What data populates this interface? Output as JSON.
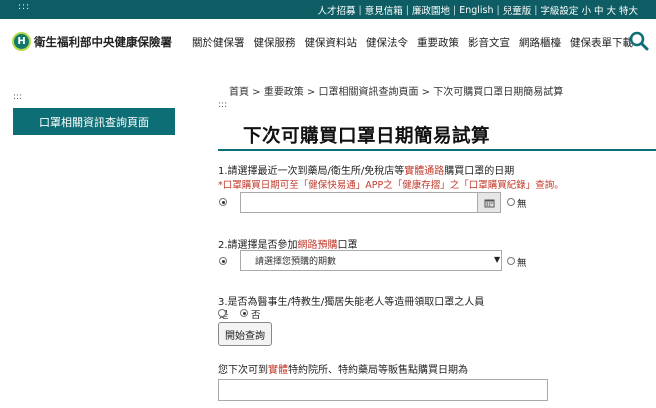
{
  "topbar": {
    "accesskey": ":::",
    "links": [
      "人才招募",
      "意見信箱",
      "廉政園地",
      "English",
      "兒童版",
      "字級設定"
    ],
    "font_sizes": [
      "小",
      "中",
      "大",
      "特大"
    ],
    "separator": "|"
  },
  "header": {
    "logo_letter": "H",
    "site_title": "衛生福利部中央健康保險署",
    "nav": [
      "關於健保署",
      "健保服務",
      "健保資料站",
      "健保法令",
      "重要政策",
      "影音文宣",
      "網路櫃檯",
      "健保表單下載"
    ]
  },
  "sidebar": {
    "accesskey": ":::",
    "button_label": "口罩相關資訊查詢頁面"
  },
  "main": {
    "breadcrumb": "首頁 > 重要政策 > 口罩相關資訊查詢頁面 > 下次可購買口罩日期簡易試算",
    "accesskey": ":::",
    "title": "下次可購買口罩日期簡易試算",
    "q1": {
      "pre": "1.請選擇最近一次到藥局/衛生所/免稅店等",
      "highlight": "實體通路",
      "post": "購買口罩的日期",
      "note": "*口罩購買日期可至「健保快易通」APP之「健康存摺」之「口罩購買紀錄」查詢。",
      "date_value": "",
      "none_label": "無"
    },
    "q2": {
      "pre": "2.請選擇是否參加",
      "highlight": "網路預購",
      "post": "口罩",
      "select_value": "請選擇您預購的期數",
      "none_label": "無"
    },
    "q3": {
      "label": "3.是否為醫事生/特教生/獨居失能老人等造冊領取口罩之人員",
      "yes_label": "是",
      "no_label": "否",
      "selected": "否"
    },
    "query_button": "開始查詢",
    "result": {
      "pre": "您下次可到",
      "highlight": "實體",
      "post": "特約院所、特約藥局等販售點購買日期為",
      "value": ""
    }
  },
  "colors": {
    "topbar": "#0e5d64",
    "accent": "#0e6e76",
    "highlight_red": "#c0392b"
  },
  "icons": {
    "search": "magnifier-icon",
    "calendar": "calendar-icon",
    "select_caret": "caret-down-icon"
  }
}
